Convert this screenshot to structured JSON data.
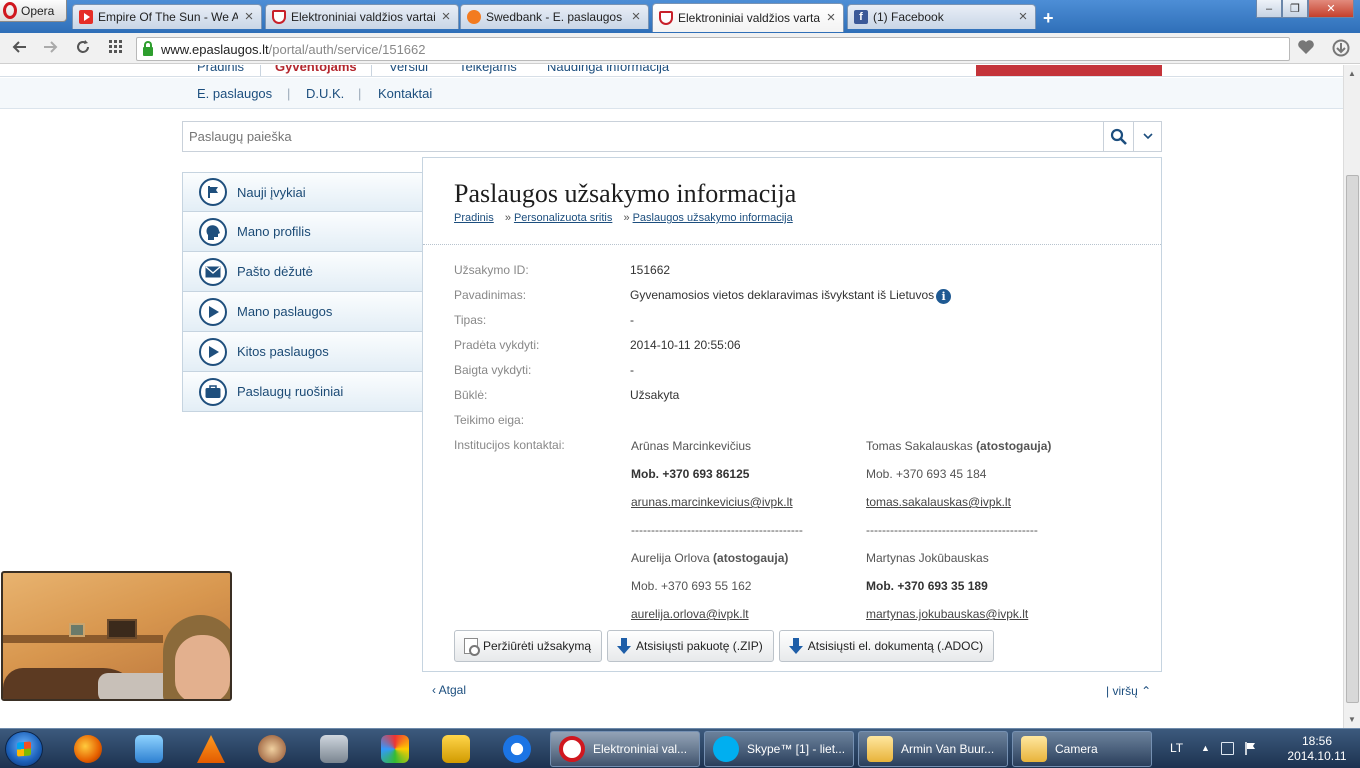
{
  "browser": {
    "opera_label": "Opera",
    "tabs": [
      {
        "title": "Empire Of The Sun - We Are",
        "favicon": "youtube-icon",
        "active": false
      },
      {
        "title": "Elektroniniai valdžios vartai",
        "favicon": "lithuania-crest-icon",
        "active": false
      },
      {
        "title": "Swedbank - E. paslaugos",
        "favicon": "swedbank-icon",
        "active": false
      },
      {
        "title": "Elektroniniai valdžios vartai",
        "favicon": "lithuania-crest-icon",
        "active": true
      },
      {
        "title": "(1) Facebook",
        "favicon": "facebook-icon",
        "active": false
      }
    ],
    "close_glyph": "×",
    "new_tab_glyph": "+",
    "url_host": "www.epaslaugos.lt",
    "url_path": "/portal/auth/service/151662",
    "window_controls": {
      "minimize": "–",
      "maximize": "❐",
      "close": "✕"
    }
  },
  "site": {
    "top_nav": [
      "Pradinis",
      "Gyventojams",
      "Verslui",
      "Teikėjams",
      "Naudinga informacija"
    ],
    "sub_nav": [
      "E. paslaugos",
      "D.U.K.",
      "Kontaktai"
    ],
    "search_placeholder": "Paslaugų paieška"
  },
  "sidebar": {
    "items": [
      {
        "label": "Nauji įvykiai",
        "icon": "flag-icon"
      },
      {
        "label": "Mano profilis",
        "icon": "profile-head-icon"
      },
      {
        "label": "Pašto dėžutė",
        "icon": "envelope-icon"
      },
      {
        "label": "Mano paslaugos",
        "icon": "play-icon"
      },
      {
        "label": "Kitos paslaugos",
        "icon": "play-icon"
      },
      {
        "label": "Paslaugų ruošiniai",
        "icon": "briefcase-icon"
      }
    ]
  },
  "content": {
    "title": "Paslaugos užsakymo informacija",
    "breadcrumbs": [
      "Pradinis",
      "Personalizuota sritis",
      "Paslaugos užsakymo informacija"
    ],
    "breadcrumb_sep": "»",
    "fields": [
      {
        "label": "Užsakymo ID:",
        "value": "151662"
      },
      {
        "label": "Pavadinimas:",
        "value": "Gyvenamosios vietos deklaravimas išvykstant iš Lietuvos"
      },
      {
        "label": "Tipas:",
        "value": "-"
      },
      {
        "label": "Pradėta vykdyti:",
        "value": "2014-10-11 20:55:06"
      },
      {
        "label": "Baigta vykdyti:",
        "value": "-"
      },
      {
        "label": "Būklė:",
        "value": "Užsakyta"
      },
      {
        "label": "Teikimo eiga:",
        "value": ""
      },
      {
        "label": "Institucijos kontaktai:",
        "value": ""
      }
    ],
    "info_glyph": "i",
    "contacts": [
      {
        "name": "Arūnas Marcinkevičius",
        "status": "",
        "phone": "Mob. +370 693 86125",
        "phone_bold": true,
        "email": "arunas.marcinkevicius@ivpk.lt"
      },
      {
        "name": "Tomas Sakalauskas",
        "status": "(atostogauja)",
        "phone": "Mob. +370 693 45 184",
        "phone_bold": false,
        "email": "tomas.sakalauskas@ivpk.lt"
      },
      {
        "name": "Aurelija Orlova",
        "status": "(atostogauja)",
        "phone": "Mob. +370 693 55 162",
        "phone_bold": false,
        "email": "aurelija.orlova@ivpk.lt"
      },
      {
        "name": "Martynas Jokūbauskas",
        "status": "",
        "phone": "Mob. +370 693 35 189",
        "phone_bold": true,
        "email": "martynas.jokubauskas@ivpk.lt"
      }
    ],
    "separator_line": "-------------------------------------------",
    "buttons": [
      "Peržiūrėti užsakymą",
      "Atsisiųsti pakuotę (.ZIP)",
      "Atsisiųsti el. dokumentą (.ADOC)"
    ],
    "back_link": "‹ Atgal",
    "top_link": "| viršų ⌃"
  },
  "taskbar": {
    "tasks": [
      {
        "label": "Elektroniniai val...",
        "icon": "opera-icon",
        "active": true
      },
      {
        "label": "Skype™ [1] - liet...",
        "icon": "skype-icon",
        "active": false
      },
      {
        "label": "Armin Van Buur...",
        "icon": "folder-icon",
        "active": false
      },
      {
        "label": "Camera",
        "icon": "folder-icon",
        "active": false
      }
    ],
    "lang": "LT",
    "tray_glyph": "▲",
    "time": "18:56",
    "date": "2014.10.11"
  }
}
